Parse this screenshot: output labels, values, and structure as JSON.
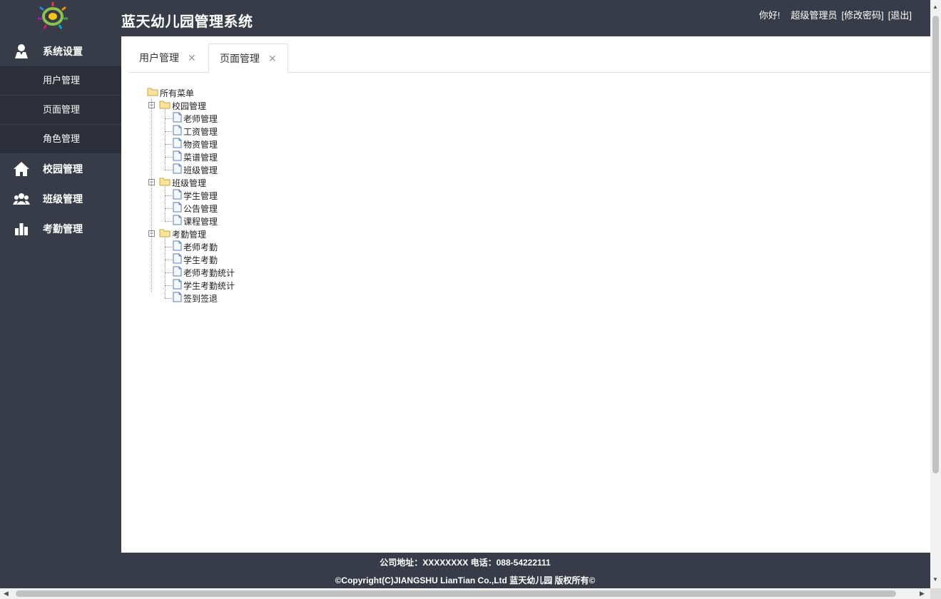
{
  "header": {
    "title": "蓝天幼儿园管理系统",
    "greeting": "你好!",
    "user_name": "超级管理员",
    "change_password": "[修改密码]",
    "logout": "[退出]"
  },
  "sidebar": {
    "groups": [
      {
        "label": "系统设置",
        "icon": "user-icon",
        "items": [
          "用户管理",
          "页面管理",
          "角色管理"
        ]
      },
      {
        "label": "校园管理",
        "icon": "home-icon"
      },
      {
        "label": "班级管理",
        "icon": "group-icon"
      },
      {
        "label": "考勤管理",
        "icon": "bar-chart-icon"
      }
    ]
  },
  "tabs": [
    {
      "label": "用户管理",
      "close": "✕",
      "active": false
    },
    {
      "label": "页面管理",
      "close": "✕",
      "active": true
    }
  ],
  "tree": {
    "root": "所有菜单",
    "expander_symbol": "−",
    "children": [
      {
        "label": "校园管理",
        "items": [
          "老师管理",
          "工资管理",
          "物资管理",
          "菜谱管理",
          "班级管理"
        ]
      },
      {
        "label": "班级管理",
        "items": [
          "学生管理",
          "公告管理",
          "课程管理"
        ]
      },
      {
        "label": "考勤管理",
        "items": [
          "老师考勤",
          "学生考勤",
          "老师考勤统计",
          "学生考勤统计",
          "签到签退"
        ]
      }
    ]
  },
  "footer": {
    "address": "公司地址：XXXXXXXX 电话：088-54222111",
    "copyright": "©Copyright(C)JIANGSHU LianTian Co.,Ltd 蓝天幼儿园 版权所有©"
  },
  "colors": {
    "chrome": "#383c48",
    "submenu_bg": "#2c2f39",
    "content_bg": "#ffffff"
  }
}
